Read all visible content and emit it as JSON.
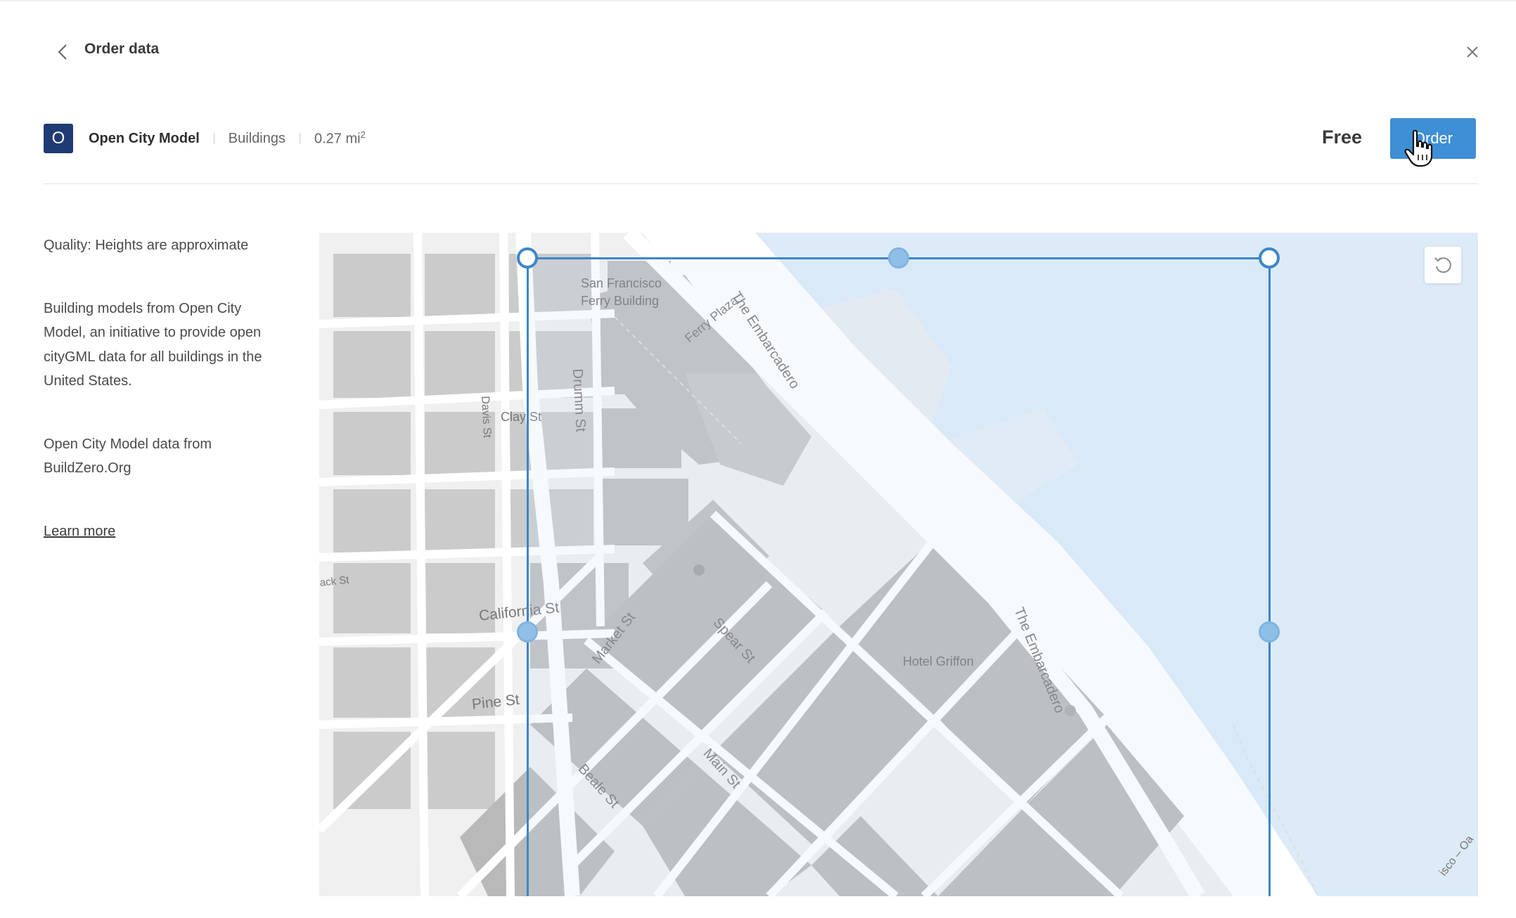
{
  "header": {
    "title": "Order data"
  },
  "product": {
    "badge": "O",
    "name": "Open City Model",
    "type": "Buildings",
    "area_value": "0.27 mi",
    "area_unit_sup": "2",
    "price": "Free",
    "order_label": "Order"
  },
  "sidebar": {
    "quality": "Quality: Heights are approximate",
    "description": "Building models from Open City Model, an initiative to provide open cityGML data for all buildings in the United States.",
    "source": "Open City Model data from BuildZero.Org",
    "learn_more": "Learn more"
  },
  "map": {
    "labels": {
      "ferry_building_1": "San Francisco",
      "ferry_building_2": "Ferry Building",
      "ferry_plaza": "Ferry Plaza",
      "embarcadero_north": "The Embarcadero",
      "embarcadero_south": "The Embarcadero",
      "drumm": "Drumm St",
      "davis": "Davis St",
      "clay": "Clay St",
      "california": "California St",
      "market": "Market St",
      "spear": "Spear St",
      "hotel_griffon": "Hotel Griffon",
      "pine": "Pine St",
      "main": "Main St",
      "beale": "Beale St",
      "front_partial": "ack St",
      "corner_partial": "isco – Oa"
    }
  },
  "colors": {
    "accent": "#3e8fd6",
    "badge": "#1f3b73",
    "selection": "#3c86c8",
    "water": "#dcebf7"
  }
}
